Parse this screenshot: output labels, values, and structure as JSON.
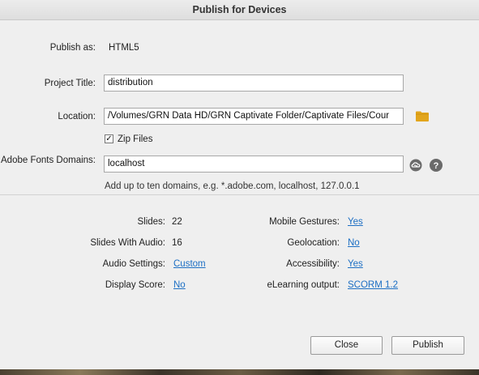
{
  "window": {
    "title": "Publish for Devices"
  },
  "publish_as": {
    "label": "Publish as:",
    "value": "HTML5"
  },
  "project_title": {
    "label": "Project Title:",
    "value": "distribution"
  },
  "location": {
    "label": "Location:",
    "value": "/Volumes/GRN Data HD/GRN Captivate Folder/Captivate Files/Cour"
  },
  "zip_files": {
    "label": "Zip Files",
    "checked": true,
    "mark": "✓"
  },
  "fonts": {
    "label": "Adobe Fonts Domains:",
    "value": "localhost",
    "hint": "Add up to ten domains, e.g. *.adobe.com, localhost, 127.0.0.1"
  },
  "stats_left": [
    {
      "label": "Slides:",
      "value": "22",
      "is_link": false
    },
    {
      "label": "Slides With Audio:",
      "value": "16",
      "is_link": false
    },
    {
      "label": "Audio Settings:",
      "value": "Custom",
      "is_link": true
    },
    {
      "label": "Display Score:",
      "value": "No",
      "is_link": true
    }
  ],
  "stats_right": [
    {
      "label": "Mobile Gestures:",
      "value": "Yes",
      "is_link": true
    },
    {
      "label": "Geolocation:",
      "value": "No",
      "is_link": true
    },
    {
      "label": "Accessibility:",
      "value": "Yes",
      "is_link": true
    },
    {
      "label": "eLearning output:",
      "value": "SCORM 1.2",
      "is_link": true
    }
  ],
  "buttons": {
    "close": "Close",
    "publish": "Publish"
  },
  "colors": {
    "link": "#1d6fc4",
    "folder": "#e2a51c"
  },
  "icons": {
    "folder": "folder-icon",
    "creative_cloud": "creative-cloud-icon",
    "help": "help-icon"
  }
}
